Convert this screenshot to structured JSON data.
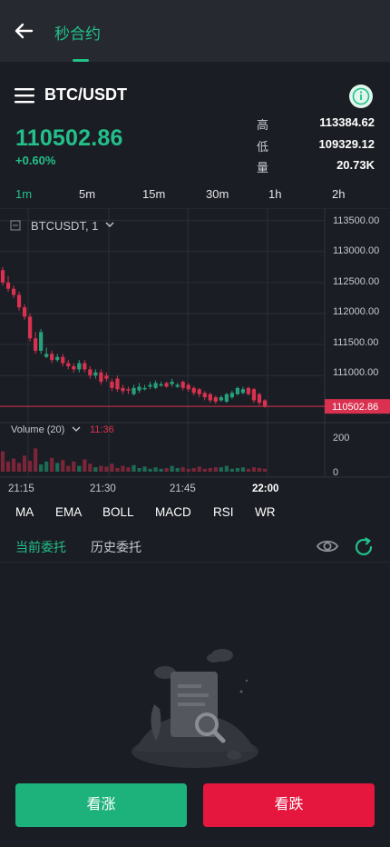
{
  "header": {
    "title": "秒合约"
  },
  "pair": {
    "name": "BTC/USDT",
    "price": "110502.86",
    "change": "+0.60%",
    "stats": [
      {
        "label": "高",
        "value": "113384.62"
      },
      {
        "label": "低",
        "value": "109329.12"
      },
      {
        "label": "量",
        "value": "20.73K"
      }
    ]
  },
  "timeframes": [
    "1m",
    "5m",
    "15m",
    "30m",
    "1h",
    "2h"
  ],
  "active_timeframe": "1m",
  "chart": {
    "symbol_label": "BTCUSDT, 1",
    "volume_label": "Volume (20)",
    "volume_time": "11:36",
    "price_axis": [
      "113500.00",
      "113000.00",
      "112500.00",
      "112000.00",
      "111500.00",
      "111000.00"
    ],
    "current_price_tag": "110502.86",
    "volume_axis": [
      "200",
      "0"
    ],
    "time_labels": [
      "21:15",
      "21:30",
      "21:45",
      "22:00"
    ]
  },
  "indicators": [
    "MA",
    "EMA",
    "BOLL",
    "MACD",
    "RSI",
    "WR"
  ],
  "order_tabs": [
    "当前委托",
    "历史委托"
  ],
  "buttons": {
    "up": "看涨",
    "down": "看跌"
  },
  "colors": {
    "accent": "#23c08a",
    "up": "#1db27c",
    "down": "#e5173f",
    "candle_down": "#d9314f",
    "candle_up": "#26a17b"
  },
  "chart_data": {
    "type": "candlestick",
    "x": [
      "21:12",
      "21:13",
      "21:14",
      "21:15",
      "21:16",
      "21:17",
      "21:18",
      "21:19",
      "21:20",
      "21:21",
      "21:22",
      "21:23",
      "21:24",
      "21:25",
      "21:26",
      "21:27",
      "21:28",
      "21:29",
      "21:30",
      "21:31",
      "21:32",
      "21:33",
      "21:34",
      "21:35",
      "21:36",
      "21:37",
      "21:38",
      "21:39",
      "21:40",
      "21:41",
      "21:42",
      "21:43",
      "21:44",
      "21:45",
      "21:46",
      "21:47",
      "21:48",
      "21:49",
      "21:50",
      "21:51",
      "21:52",
      "21:53",
      "21:54",
      "21:55",
      "21:56",
      "21:57",
      "21:58",
      "21:59",
      "22:00"
    ],
    "open": [
      112700,
      112500,
      112400,
      112300,
      112100,
      111950,
      111600,
      111400,
      111300,
      111350,
      111250,
      111300,
      111200,
      111150,
      111100,
      111200,
      111100,
      111000,
      111050,
      111000,
      110900,
      110950,
      110800,
      110780,
      110700,
      110760,
      110800,
      110820,
      110800,
      110850,
      110880,
      110860,
      110820,
      110900,
      110850,
      110800,
      110780,
      110720,
      110700,
      110650,
      110600,
      110580,
      110650,
      110700,
      110720,
      110800,
      110780,
      110700,
      110600
    ],
    "close": [
      112500,
      112400,
      112300,
      112100,
      111950,
      111600,
      111400,
      111700,
      111350,
      111250,
      111300,
      111200,
      111150,
      111100,
      111200,
      111100,
      111000,
      111050,
      110900,
      110950,
      110800,
      110780,
      110750,
      110760,
      110800,
      110820,
      110800,
      110850,
      110880,
      110860,
      110820,
      110900,
      110850,
      110800,
      110780,
      110720,
      110700,
      110650,
      110600,
      110580,
      110650,
      110700,
      110720,
      110800,
      110780,
      110700,
      110600,
      110560,
      110502
    ],
    "high": [
      112750,
      112600,
      112450,
      112350,
      112150,
      112000,
      111700,
      111750,
      111450,
      111400,
      111350,
      111350,
      111250,
      111200,
      111250,
      111250,
      111150,
      111100,
      111100,
      111050,
      110950,
      111000,
      110850,
      110820,
      110850,
      110880,
      110850,
      110900,
      110920,
      110900,
      110900,
      110950,
      110880,
      110920,
      110880,
      110830,
      110800,
      110750,
      110720,
      110680,
      110680,
      110720,
      110760,
      110820,
      110820,
      110820,
      110800,
      110720,
      110620
    ],
    "low": [
      112450,
      112350,
      112250,
      112050,
      111900,
      111550,
      111350,
      111350,
      111280,
      111200,
      111220,
      111150,
      111100,
      111050,
      111050,
      111050,
      110950,
      110950,
      110850,
      110900,
      110750,
      110740,
      110700,
      110700,
      110680,
      110720,
      110760,
      110780,
      110780,
      110820,
      110800,
      110820,
      110800,
      110760,
      110740,
      110680,
      110650,
      110600,
      110560,
      110540,
      110580,
      110560,
      110620,
      110680,
      110700,
      110680,
      110560,
      110520,
      110480
    ],
    "volume": [
      140,
      70,
      90,
      60,
      110,
      75,
      160,
      50,
      70,
      95,
      60,
      80,
      40,
      70,
      40,
      85,
      55,
      30,
      40,
      35,
      55,
      25,
      40,
      30,
      45,
      25,
      35,
      20,
      30,
      20,
      25,
      40,
      25,
      30,
      20,
      25,
      35,
      20,
      25,
      30,
      30,
      40,
      20,
      25,
      30,
      20,
      30,
      25,
      20
    ],
    "ylim": [
      110300,
      113700
    ],
    "volume_ylim": [
      0,
      250
    ]
  }
}
